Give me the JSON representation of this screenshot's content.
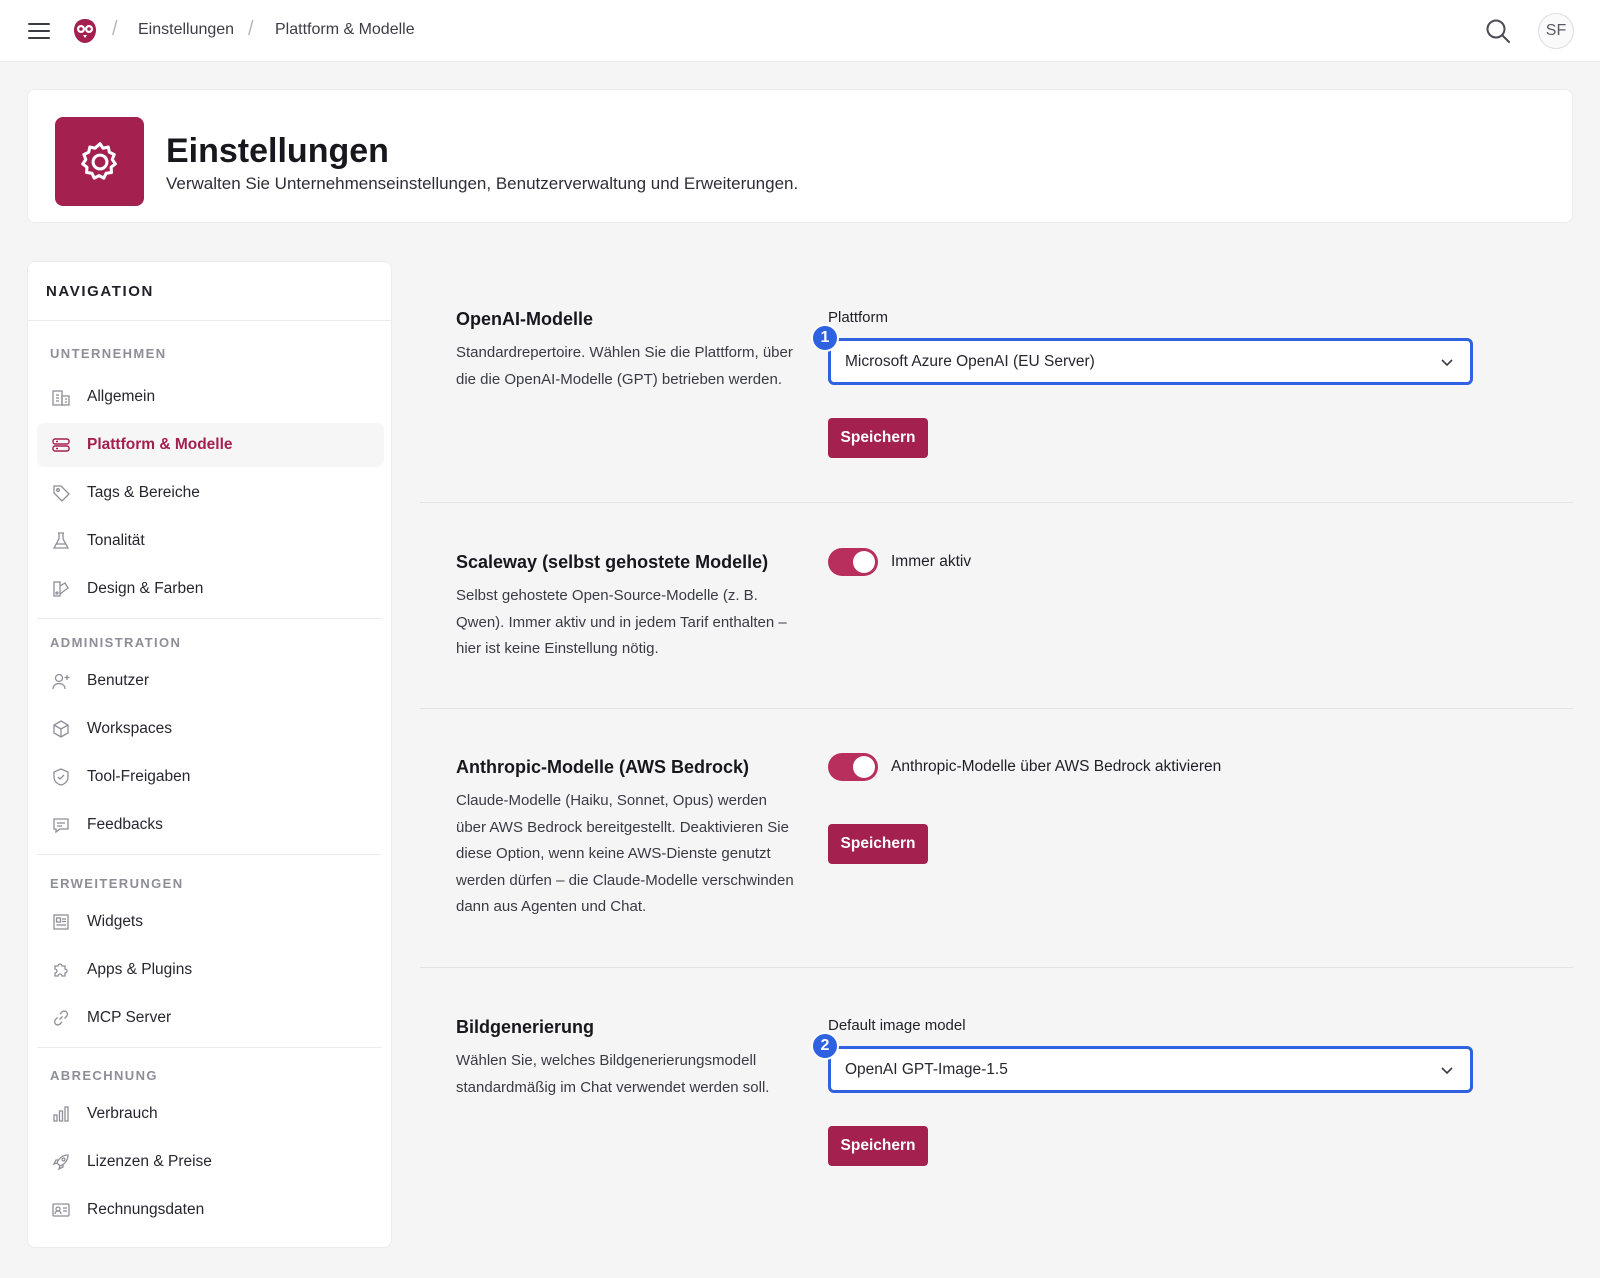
{
  "breadcrumb": {
    "items": [
      "Einstellungen",
      "Plattform & Modelle"
    ]
  },
  "user": {
    "initials": "SF"
  },
  "header": {
    "title": "Einstellungen",
    "subtitle": "Verwalten Sie Unternehmenseinstellungen, Benutzerverwaltung und Erweiterungen."
  },
  "nav": {
    "title": "NAVIGATION",
    "groups": [
      {
        "label": "UNTERNEHMEN",
        "items": [
          {
            "label": "Allgemein",
            "icon": "building-icon"
          },
          {
            "label": "Plattform & Modelle",
            "icon": "server-icon",
            "active": true
          },
          {
            "label": "Tags & Bereiche",
            "icon": "tag-icon"
          },
          {
            "label": "Tonalität",
            "icon": "flask-icon"
          },
          {
            "label": "Design & Farben",
            "icon": "palette-icon"
          }
        ]
      },
      {
        "label": "ADMINISTRATION",
        "items": [
          {
            "label": "Benutzer",
            "icon": "user-plus-icon"
          },
          {
            "label": "Workspaces",
            "icon": "cube-icon"
          },
          {
            "label": "Tool-Freigaben",
            "icon": "shield-check-icon"
          },
          {
            "label": "Feedbacks",
            "icon": "chat-icon"
          }
        ]
      },
      {
        "label": "ERWEITERUNGEN",
        "items": [
          {
            "label": "Widgets",
            "icon": "newspaper-icon"
          },
          {
            "label": "Apps & Plugins",
            "icon": "puzzle-icon"
          },
          {
            "label": "MCP Server",
            "icon": "link-icon"
          }
        ]
      },
      {
        "label": "ABRECHNUNG",
        "items": [
          {
            "label": "Verbrauch",
            "icon": "bar-chart-icon"
          },
          {
            "label": "Lizenzen & Preise",
            "icon": "rocket-icon"
          },
          {
            "label": "Rechnungsdaten",
            "icon": "id-card-icon"
          }
        ]
      }
    ]
  },
  "sections": {
    "openai": {
      "title": "OpenAI-Modelle",
      "description": "Standardrepertoire. Wählen Sie die Plattform, über die die OpenAI-Modelle (GPT) betrieben werden.",
      "field_label": "Plattform",
      "select_value": "Microsoft Azure OpenAI (EU Server)",
      "badge": "1",
      "save_label": "Speichern"
    },
    "scaleway": {
      "title": "Scaleway (selbst gehostete Modelle)",
      "description": "Selbst gehostete Open-Source-Modelle (z. B. Qwen). Immer aktiv und in jedem Tarif enthalten – hier ist keine Einstellung nötig.",
      "toggle_label": "Immer aktiv",
      "toggle_on": true
    },
    "anthropic": {
      "title": "Anthropic-Modelle (AWS Bedrock)",
      "description": "Claude-Modelle (Haiku, Sonnet, Opus) werden über AWS Bedrock bereitgestellt. Deaktivieren Sie diese Option, wenn keine AWS-Dienste genutzt werden dürfen – die Claude-Modelle verschwinden dann aus Agenten und Chat.",
      "toggle_label": "Anthropic-Modelle über AWS Bedrock aktivieren",
      "toggle_on": true,
      "save_label": "Speichern"
    },
    "image": {
      "title": "Bildgenerierung",
      "description": "Wählen Sie, welches Bildgenerierungsmodell standardmäßig im Chat verwendet werden soll.",
      "field_label": "Default image model",
      "select_value": "OpenAI GPT-Image-1.5",
      "badge": "2",
      "save_label": "Speichern"
    }
  },
  "colors": {
    "brand": "#a3204f",
    "focus": "#2f62e0",
    "toggle": "#b82f5e"
  }
}
